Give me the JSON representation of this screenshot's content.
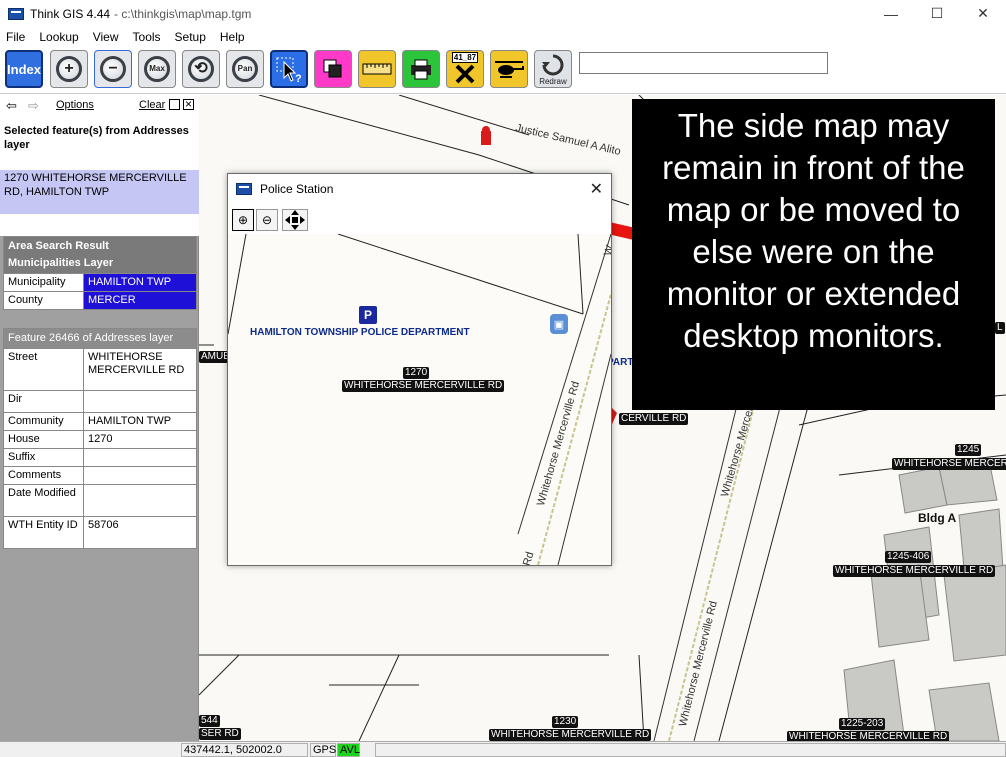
{
  "window": {
    "title": "Think GIS 4.44",
    "path": "- c:\\thinkgis\\map\\map.tgm",
    "minimize": "—",
    "maximize": "☐",
    "close": "✕"
  },
  "menu": [
    "File",
    "Lookup",
    "View",
    "Tools",
    "Setup",
    "Help"
  ],
  "toolbar": {
    "index_label": "Index",
    "zoom_in_label": "+",
    "zoom_out_label": "−",
    "max_label": "Max",
    "pan_label": "Pan",
    "redraw_label": "Redraw",
    "cross_label": "41_87",
    "search_value": ""
  },
  "left_panel": {
    "back_icon": "⇦",
    "fwd_icon": "⇨",
    "options_label": "Options",
    "clear_label": "Clear",
    "selected_header": "Selected feature(s) from Addresses layer",
    "selected_item": "1270 WHITEHORSE MERCERVILLE RD, HAMILTON TWP",
    "area_search_header": "Area Search Result",
    "municipalities_header": "Municipalities Layer",
    "area_rows": [
      {
        "k": "Municipality",
        "v": "HAMILTON TWP"
      },
      {
        "k": "County",
        "v": "MERCER"
      }
    ],
    "feature_header": "Feature 26466 of Addresses layer",
    "feature_rows": [
      {
        "k": "Street",
        "v": "WHITEHORSE MERCERVILLE RD"
      },
      {
        "k": "Dir",
        "v": ""
      },
      {
        "k": "Community",
        "v": "HAMILTON TWP"
      },
      {
        "k": "House",
        "v": "1270"
      },
      {
        "k": "Suffix",
        "v": ""
      },
      {
        "k": "Comments",
        "v": ""
      },
      {
        "k": "Date Modified",
        "v": ""
      },
      {
        "k": "WTH Entity ID",
        "v": "58706"
      }
    ]
  },
  "popup": {
    "title": "Police Station",
    "close_icon": "✕",
    "police_label": "HAMILTON TOWNSHIP POLICE DEPARTMENT",
    "p_marker": "P",
    "address_number": "1270",
    "address_street": "WHITEHORSE MERCERVILLE RD",
    "road_label": "Whitehorse Mercerville Rd",
    "road_label_2": "Rd",
    "road_partial": "W"
  },
  "map": {
    "road_justice": "Justice Samuel A Alito",
    "road_whitehorse_1": "Whitehorse Mercerville",
    "road_whitehorse_2": "Whitehorse Mercerville Rd",
    "labels": {
      "amue": "AMUE",
      "part": "PART",
      "mercer_frag": "CERVILLE RD",
      "n1245": "1245",
      "wm_1245": "WHITEHORSE MERCERV",
      "bldg_a": "Bldg A",
      "n1245_406": "1245-406",
      "wm_1245_406": "WHITEHORSE MERCERVILLE RD",
      "n544": "544",
      "ser_rd": "SER RD",
      "n1230": "1230",
      "wm_1230": "WHITEHORSE MERCERVILLE RD",
      "n1225_203": "1225-203",
      "wm_1225": "WHITEHORSE MERCERVILLE RD",
      "edge_frag": "L"
    }
  },
  "callout": {
    "text": "The side map may remain in front of the map or be moved to else were on the monitor or extended desktop monitors."
  },
  "status": {
    "coords": "437442.1, 502002.0",
    "gps": "GPS",
    "avl": "AVL"
  },
  "colors": {
    "selection_bg": "#c6c6f4",
    "value_blue": "#1f10d8",
    "avl_green": "#1bd41b",
    "arrow_red": "#e8140f",
    "police_blue": "#0d2a8a"
  }
}
